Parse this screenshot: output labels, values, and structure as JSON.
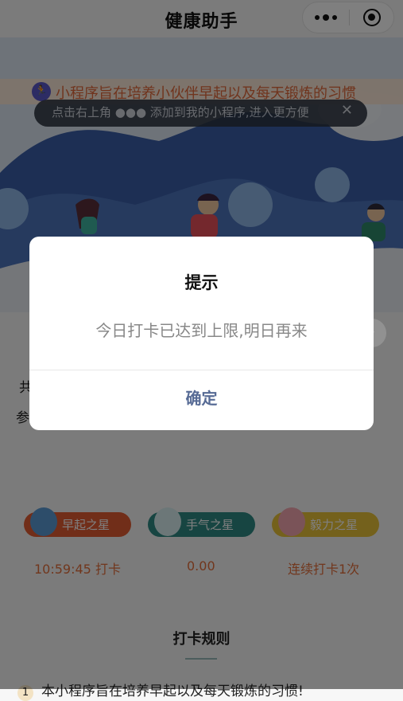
{
  "nav": {
    "title": "健康助手"
  },
  "notice": {
    "text": "小程序旨在培养小伙伴早起以及每天锻炼的习惯"
  },
  "tip": {
    "text": "点击右上角 ●●● 添加到我的小程序,进入更方便",
    "close": "✕"
  },
  "page": {
    "text1": "共",
    "text2": "参"
  },
  "badges": [
    {
      "label": "早起之星",
      "color": "#e35d33",
      "icon": "alarm-clock-icon",
      "icon_color": "#5b9bd5"
    },
    {
      "label": "手气之星",
      "color": "#2f8a84",
      "icon": "gift-box-icon",
      "icon_color": "#d8eef0"
    },
    {
      "label": "毅力之星",
      "color": "#e8c238",
      "icon": "book-icon",
      "icon_color": "#f4a7b0"
    }
  ],
  "stats": {
    "time": "10:59:45 打卡",
    "amount": "0.00",
    "streak": "连续打卡1次"
  },
  "rules": {
    "title": "打卡规则",
    "item1_num": "1",
    "item1_text": "本小程序旨在培养早起以及每天锻炼的习惯!"
  },
  "dialog": {
    "title": "提示",
    "content": "今日打卡已达到上限,明日再来",
    "confirm": "确定"
  },
  "colors": {
    "accent_orange": "#e36e3b",
    "dialog_button": "#576b95"
  }
}
